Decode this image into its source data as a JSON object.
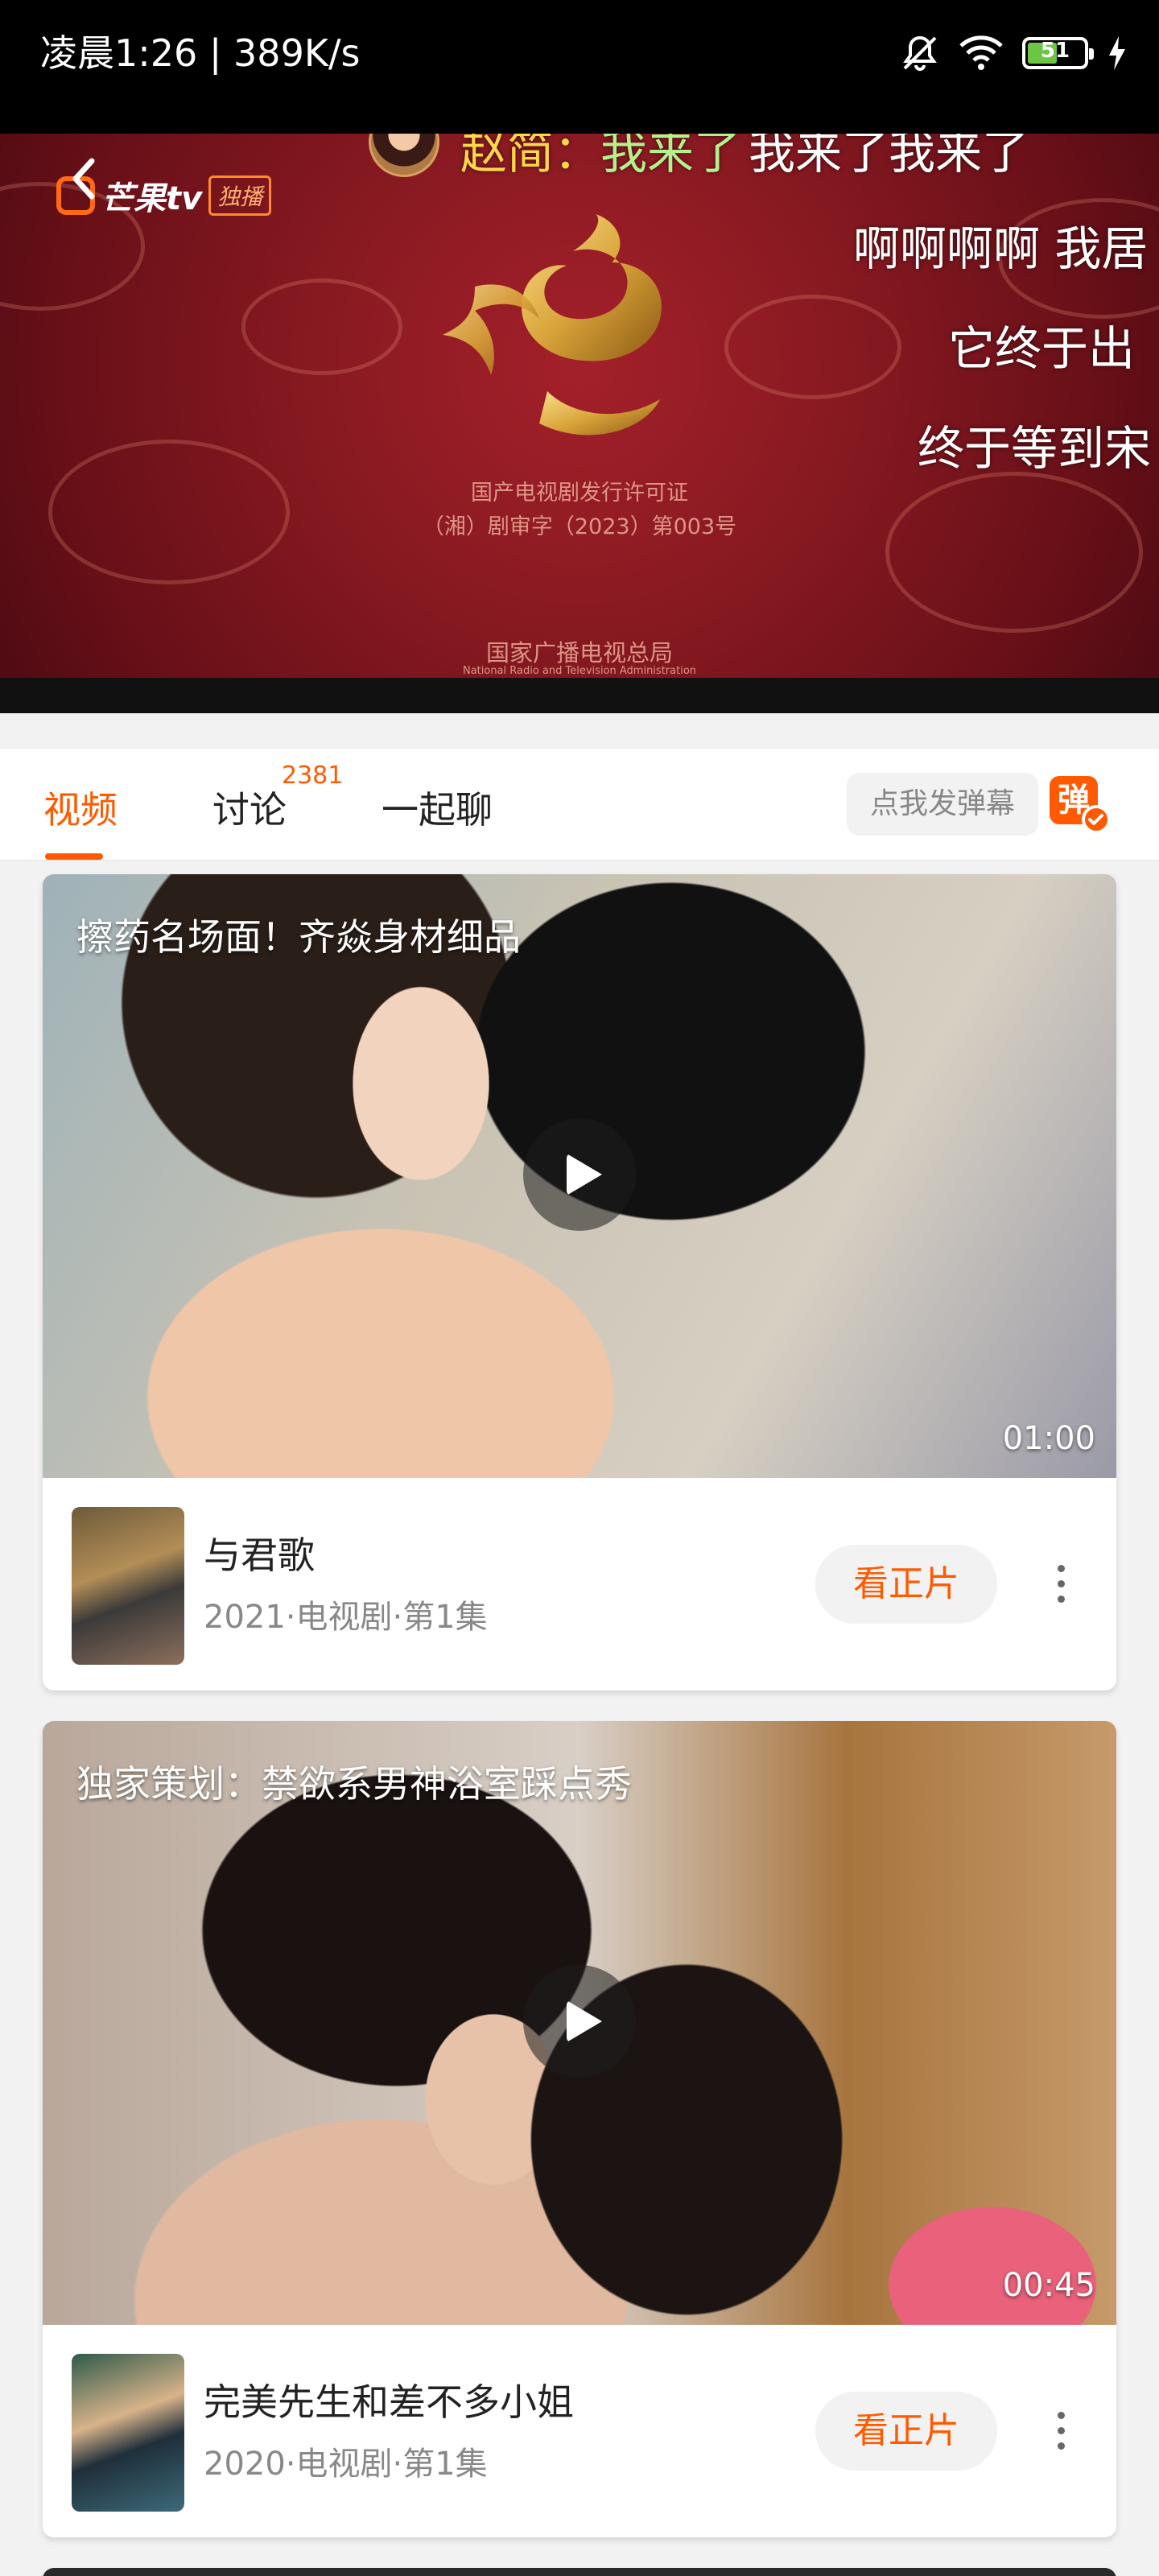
{
  "status_bar": {
    "time_speed": "凌晨1:26 | 389K/s",
    "battery_level": "51"
  },
  "player": {
    "brand": "芒果tv",
    "brand_badge": "独播",
    "license_line1": "国产电视剧发行许可证",
    "license_line2": "（湘）剧审字（2023）第003号",
    "authority": "国家广播电视总局",
    "authority_en": "National Radio and Television Administration",
    "danmaku": {
      "first": {
        "user": "赵简",
        "colon": "：",
        "msg_green": "我来了",
        "msg_white": "我来了我来了"
      },
      "line2": "啊啊啊啊 我居",
      "line3": "它终于出",
      "line4": "终于等到宋"
    }
  },
  "tabs": {
    "video": "视频",
    "discuss": "讨论",
    "discuss_count": "2381",
    "chat": "一起聊",
    "danmu_placeholder": "点我发弹幕",
    "danmu_toggle": "弹"
  },
  "cards": [
    {
      "caption": "擦药名场面！齐焱身材细品",
      "duration": "01:00",
      "title": "与君歌",
      "meta": "2021·电视剧·第1集",
      "watch_label": "看正片"
    },
    {
      "caption": "独家策划：禁欲系男神浴室踩点秀",
      "duration": "00:45",
      "title": "完美先生和差不多小姐",
      "meta": "2020·电视剧·第1集",
      "watch_label": "看正片"
    }
  ],
  "colors": {
    "accent": "#ff5a00",
    "player_bg": "#8b1a22"
  }
}
